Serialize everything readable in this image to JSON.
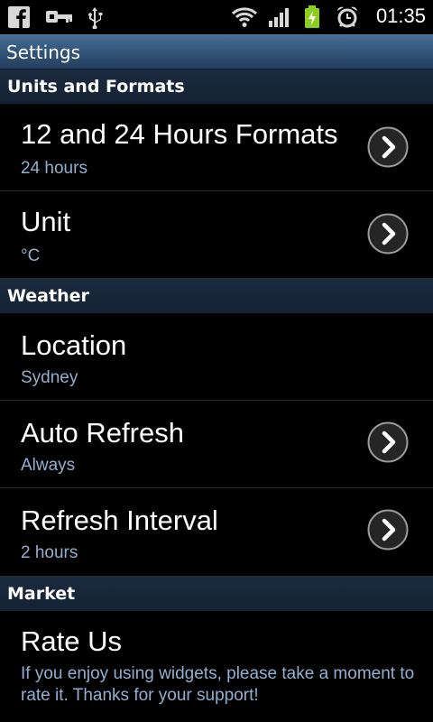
{
  "status_bar": {
    "time": "01:35",
    "icons": [
      "facebook-icon",
      "key-icon",
      "usb-icon",
      "wifi-icon",
      "signal-icon",
      "battery-charging-icon",
      "alarm-icon"
    ]
  },
  "title_bar": {
    "title": "Settings"
  },
  "sections": {
    "units": "Units and Formats",
    "weather": "Weather",
    "market": "Market"
  },
  "items": {
    "hours_format": {
      "title": "12 and 24 Hours Formats",
      "value": "24 hours"
    },
    "unit": {
      "title": "Unit",
      "value": "°C"
    },
    "location": {
      "title": "Location",
      "value": "Sydney"
    },
    "auto_refresh": {
      "title": "Auto Refresh",
      "value": "Always"
    },
    "refresh_interval": {
      "title": "Refresh Interval",
      "value": "2 hours"
    },
    "rate_us": {
      "title": "Rate Us",
      "description": "If you enjoy using widgets, please take a moment to rate it. Thanks for your support!"
    }
  },
  "colors": {
    "title_bar": "#34577c",
    "section_header": "#1b2b3f",
    "subtitle_text": "#8fb0cf",
    "battery": "#8ccf1e"
  }
}
